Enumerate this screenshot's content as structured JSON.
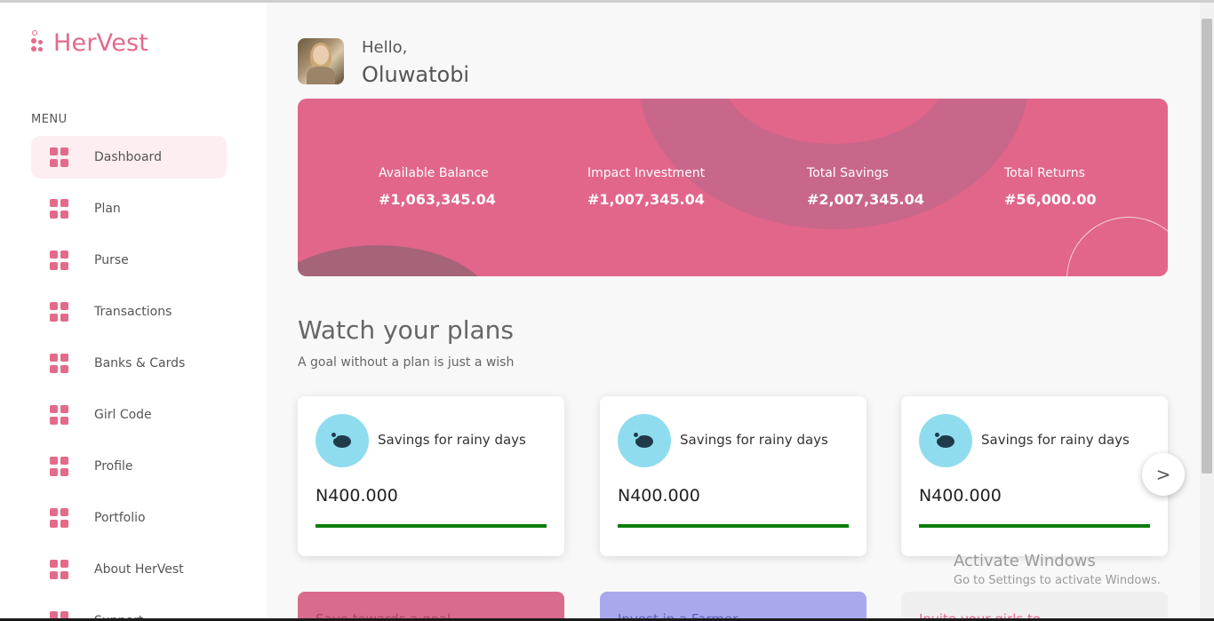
{
  "brand": {
    "name": "HerVest",
    "accent": "#e46a8a"
  },
  "sidebar": {
    "menu_heading": "MENU",
    "items": [
      {
        "label": "Dashboard",
        "icon": "grid-icon",
        "active": true
      },
      {
        "label": "Plan",
        "icon": "grid-icon"
      },
      {
        "label": "Purse",
        "icon": "grid-icon"
      },
      {
        "label": "Transactions",
        "icon": "grid-icon"
      },
      {
        "label": "Banks & Cards",
        "icon": "grid-icon"
      },
      {
        "label": "Girl Code",
        "icon": "grid-icon"
      },
      {
        "label": "Profile",
        "icon": "grid-icon"
      },
      {
        "label": "Portfolio",
        "icon": "grid-icon"
      },
      {
        "label": "About HerVest",
        "icon": "grid-icon"
      },
      {
        "label": "Support",
        "icon": "grid-icon"
      }
    ]
  },
  "greeting": {
    "hello": "Hello,",
    "name": "Oluwatobi"
  },
  "banner": {
    "color": "#e2668a",
    "stats": [
      {
        "label": "Available Balance",
        "value": "#1,063,345.04"
      },
      {
        "label": "Impact Investment",
        "value": "#1,007,345.04"
      },
      {
        "label": "Total Savings",
        "value": "#2,007,345.04"
      },
      {
        "label": "Total Returns",
        "value": "#56,000.00"
      }
    ]
  },
  "plans_section": {
    "title": "Watch your plans",
    "subtitle": "A goal without a plan is just a wish",
    "next_label": ">",
    "cards": [
      {
        "title": "Savings for rainy days",
        "amount": "N400.000",
        "icon": "piggy-bank-icon",
        "progress": 1.0
      },
      {
        "title": "Savings for rainy days",
        "amount": "N400.000",
        "icon": "piggy-bank-icon",
        "progress": 1.0
      },
      {
        "title": "Savings for rainy days",
        "amount": "N400.000",
        "icon": "piggy-bank-icon",
        "progress": 1.0
      }
    ]
  },
  "bottom_cards": [
    {
      "label": "Save towards a goal",
      "bg": "#d96b8c",
      "color": "#a3455f"
    },
    {
      "label": "Invest in a Farmer",
      "bg": "#a9a8ef",
      "color": "#5e5db8"
    },
    {
      "label": "Invite your girls to",
      "bg": "#efefef",
      "color": "#e2668a"
    }
  ],
  "watermark": {
    "title": "Activate Windows",
    "subtitle": "Go to Settings to activate Windows."
  }
}
